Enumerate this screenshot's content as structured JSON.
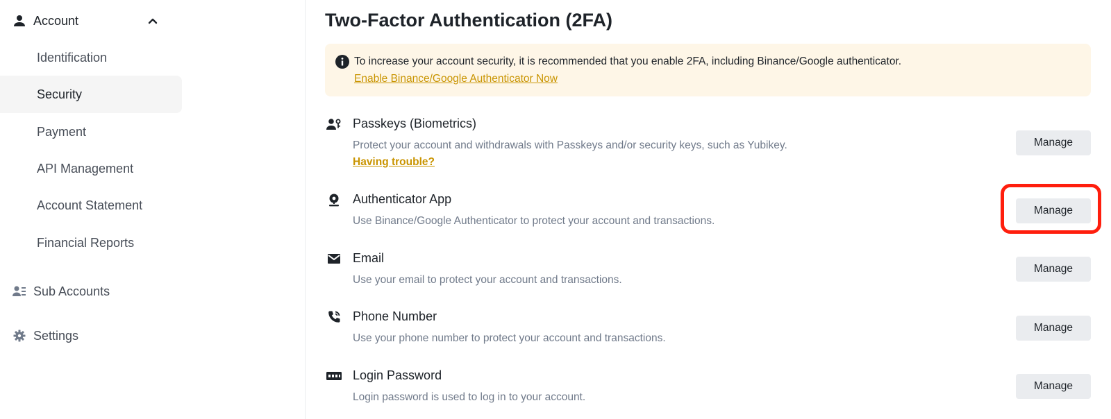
{
  "sidebar": {
    "account_label": "Account",
    "items": [
      {
        "label": "Identification"
      },
      {
        "label": "Security"
      },
      {
        "label": "Payment"
      },
      {
        "label": "API Management"
      },
      {
        "label": "Account Statement"
      },
      {
        "label": "Financial Reports"
      }
    ],
    "active_item": "Security",
    "sub_accounts_label": "Sub Accounts",
    "settings_label": "Settings"
  },
  "main": {
    "title": "Two-Factor Authentication (2FA)",
    "notice": {
      "text": "To increase your account security, it is recommended that you enable 2FA, including Binance/Google authenticator.",
      "link": "Enable Binance/Google Authenticator Now"
    },
    "methods": [
      {
        "icon": "passkeys-icon",
        "title": "Passkeys (Biometrics)",
        "description": "Protect your account and withdrawals with Passkeys and/or security keys, such as Yubikey.",
        "link": "Having trouble?",
        "button": "Manage"
      },
      {
        "icon": "authenticator-icon",
        "title": "Authenticator App",
        "description": "Use Binance/Google Authenticator to protect your account and transactions.",
        "button": "Manage"
      },
      {
        "icon": "email-icon",
        "title": "Email",
        "description": "Use your email to protect your account and transactions.",
        "button": "Manage"
      },
      {
        "icon": "phone-icon",
        "title": "Phone Number",
        "description": "Use your phone number to protect your account and transactions.",
        "button": "Manage"
      },
      {
        "icon": "password-icon",
        "title": "Login Password",
        "description": "Login password is used to log in to your account.",
        "button": "Manage"
      }
    ]
  },
  "colors": {
    "accent_link": "#c99400",
    "notice_bg": "#fef6e7",
    "button_bg": "#eaecef",
    "active_nav_bg": "#f5f5f5",
    "highlight": "#ff1e0d"
  }
}
